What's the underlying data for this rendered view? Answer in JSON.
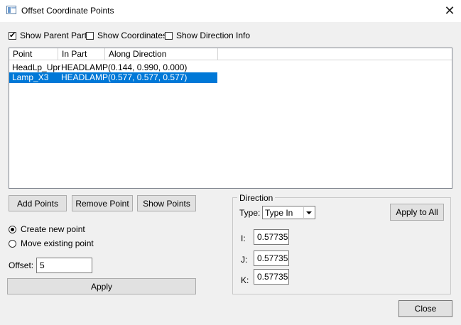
{
  "window": {
    "title": "Offset Coordinate Points",
    "close_glyph": "✕"
  },
  "options": {
    "show_parent_part": {
      "label": "Show Parent Part",
      "checked": true
    },
    "show_coordinates": {
      "label": "Show Coordinates",
      "checked": false
    },
    "show_direction_info": {
      "label": "Show Direction Info",
      "checked": false
    }
  },
  "table": {
    "columns": [
      "Point",
      "In Part",
      "Along Direction"
    ],
    "rows": [
      {
        "point": "HeadLp_Upr",
        "part": "HEADLAMP",
        "direction": "(0.144, 0.990, 0.000)",
        "selected": false
      },
      {
        "point": "Lamp_X3",
        "part": "HEADLAMP",
        "direction": "(0.577, 0.577, 0.577)",
        "selected": true
      }
    ]
  },
  "buttons": {
    "add_points": "Add Points",
    "remove_point": "Remove Point",
    "show_points": "Show Points",
    "apply": "Apply",
    "apply_to_all": "Apply to All",
    "close": "Close"
  },
  "mode": {
    "create_new": {
      "label": "Create new point",
      "selected": true
    },
    "move_existing": {
      "label": "Move existing point",
      "selected": false
    }
  },
  "offset": {
    "label": "Offset:",
    "value": "5"
  },
  "direction": {
    "group_label": "Direction",
    "type_label": "Type:",
    "type_value": "Type In",
    "i_label": "I:",
    "i_value": "0.57735",
    "j_label": "J:",
    "j_value": "0.57735",
    "k_label": "K:",
    "k_value": "0.57735"
  },
  "colors": {
    "selection": "#0078d7",
    "background": "#f0f0f0"
  }
}
